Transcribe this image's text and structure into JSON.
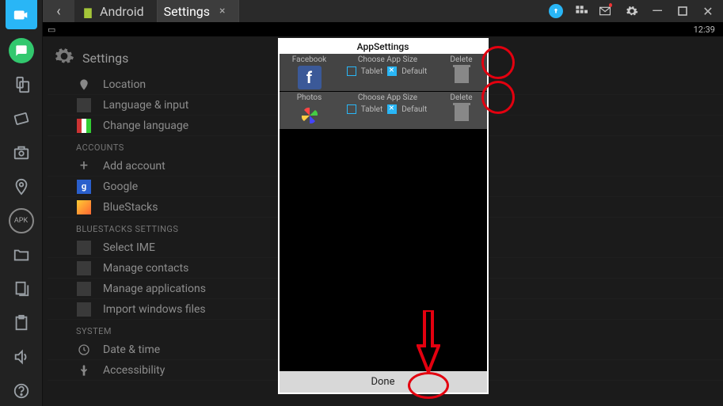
{
  "titlebar": {
    "tabs": [
      {
        "label": "Android"
      },
      {
        "label": "Settings"
      }
    ]
  },
  "statusbar": {
    "time": "12:39"
  },
  "settings": {
    "header": "Settings",
    "groups": [
      {
        "items": [
          {
            "label": "Location",
            "icon": "location"
          },
          {
            "label": "Language & input",
            "icon": "sq"
          },
          {
            "label": "Change language",
            "icon": "flag"
          }
        ]
      },
      {
        "label": "ACCOUNTS",
        "items": [
          {
            "label": "Add account",
            "icon": "plus"
          },
          {
            "label": "Google",
            "icon": "g"
          },
          {
            "label": "BlueStacks",
            "icon": "bs"
          }
        ]
      },
      {
        "label": "BLUESTACKS SETTINGS",
        "items": [
          {
            "label": "Select IME",
            "icon": "sq"
          },
          {
            "label": "Manage contacts",
            "icon": "sq"
          },
          {
            "label": "Manage applications",
            "icon": "sq"
          },
          {
            "label": "Import windows files",
            "icon": "sq"
          }
        ]
      },
      {
        "label": "SYSTEM",
        "items": [
          {
            "label": "Date & time",
            "icon": "clock"
          },
          {
            "label": "Accessibility",
            "icon": "hand"
          }
        ]
      }
    ]
  },
  "dialog": {
    "title": "AppSettings",
    "columns": {
      "size": "Choose App Size",
      "delete": "Delete"
    },
    "sizeOptions": {
      "tablet": "Tablet",
      "default": "Default"
    },
    "apps": [
      {
        "name": "Facebook",
        "icon": "facebook"
      },
      {
        "name": "Photos",
        "icon": "photos"
      }
    ],
    "done": "Done"
  }
}
